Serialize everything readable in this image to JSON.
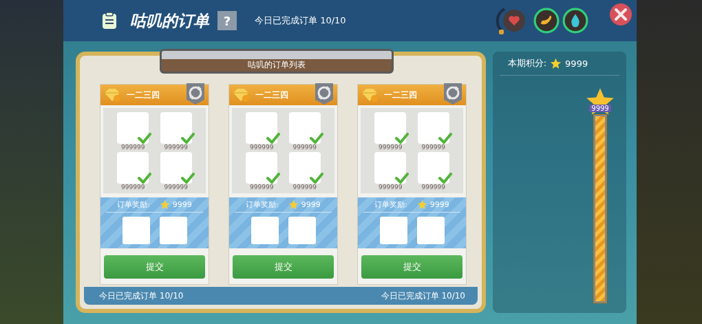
{
  "header": {
    "title": "咕叽的订单",
    "help": "?",
    "progress": "今日已完成订单 10/10"
  },
  "board": {
    "title": "咕叽的订单列表",
    "orders": [
      {
        "name": "一二三四",
        "reward_label": "订单奖励:",
        "reward": "9999",
        "submit": "提交",
        "items": [
          {
            "count": "999999",
            "checked": true
          },
          {
            "count": "999999",
            "checked": true
          },
          {
            "count": "999999",
            "checked": true
          },
          {
            "count": "999999",
            "checked": true
          }
        ]
      },
      {
        "name": "一二三四",
        "reward_label": "订单奖励:",
        "reward": "9999",
        "submit": "提交",
        "items": [
          {
            "count": "999999",
            "checked": true
          },
          {
            "count": "999999",
            "checked": true
          },
          {
            "count": "999999",
            "checked": true
          },
          {
            "count": "999999",
            "checked": true
          }
        ]
      },
      {
        "name": "一二三四",
        "reward_label": "订单奖励:",
        "reward": "9999",
        "submit": "提交",
        "items": [
          {
            "count": "999999",
            "checked": true
          },
          {
            "count": "999999",
            "checked": true
          },
          {
            "count": "999999",
            "checked": true
          },
          {
            "count": "999999",
            "checked": true
          }
        ]
      }
    ],
    "footer_left": "今日已完成订单 10/10",
    "footer_right": "今日已完成订单 10/10"
  },
  "score": {
    "label": "本期积分:",
    "value": "9999",
    "meter_value": "9999",
    "level": 1
  }
}
